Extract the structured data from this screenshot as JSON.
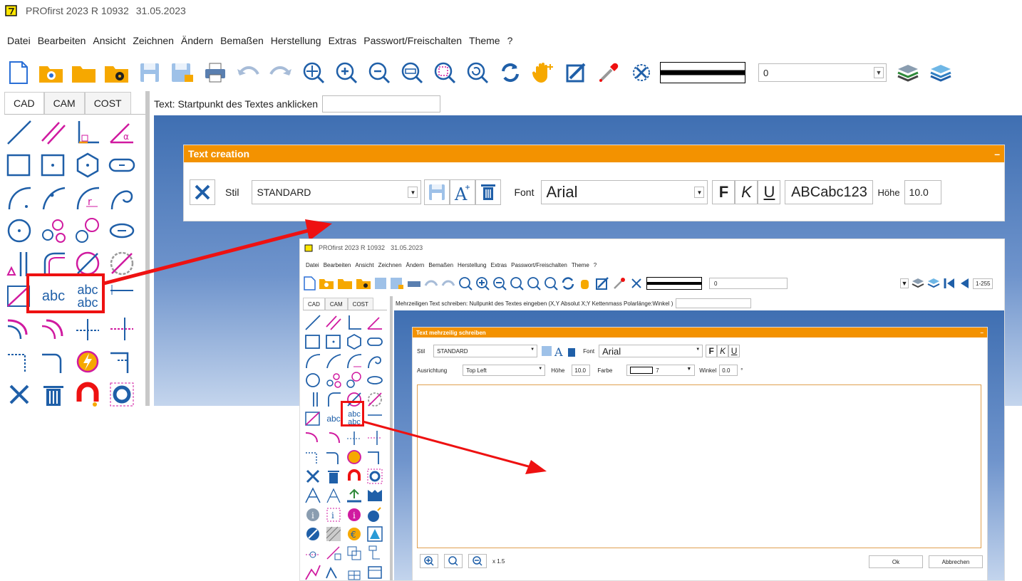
{
  "header_caption": "",
  "app": {
    "title": "PROfirst 2023 R 10932",
    "date": "31.05.2023"
  },
  "menu": [
    "Datei",
    "Bearbeiten",
    "Ansicht",
    "Zeichnen",
    "Ändern",
    "Bemaßen",
    "Herstellung",
    "Extras",
    "Passwort/Freischalten",
    "Theme",
    "?"
  ],
  "toolbar": {
    "layer_value": "0"
  },
  "tabs": [
    "CAD",
    "CAM",
    "COST"
  ],
  "prompt": {
    "text": "Text: Startpunkt des Textes anklicken",
    "value": ""
  },
  "text_creation": {
    "title": "Text creation",
    "collapse": "–",
    "stil_label": "Stil",
    "stil_value": "STANDARD",
    "font_label": "Font",
    "font_value": "Arial",
    "bold": "F",
    "italic": "K",
    "underline": "U",
    "preview": "ABCabc123",
    "hoehe_label": "Höhe",
    "hoehe_value": "10.0"
  },
  "palette_text": {
    "abc": "abc",
    "abc2": "abc"
  },
  "inset": {
    "app": {
      "title": "PROfirst 2023 R 10932",
      "date": "31.05.2023"
    },
    "menu": [
      "Datei",
      "Bearbeiten",
      "Ansicht",
      "Zeichnen",
      "Ändern",
      "Bemaßen",
      "Herstellung",
      "Extras",
      "Passwort/Freischalten",
      "Theme",
      "?"
    ],
    "layer_value": "0",
    "range": "1-255",
    "tabs": [
      "CAD",
      "CAM",
      "COST"
    ],
    "prompt": "Mehrzeiligen Text schreiben: Nullpunkt des Textes eingeben  (X,Y Absolut X;Y Kettenmass Polarlänge:Winkel )",
    "panel": {
      "title": "Text mehrzeilig schreiben",
      "collapse": "–",
      "stil_label": "Stil",
      "stil_value": "STANDARD",
      "font_label": "Font",
      "font_value": "Arial",
      "bold": "F",
      "italic": "K",
      "underline": "U",
      "ausrichtung_label": "Ausrichtung",
      "ausrichtung_value": "Top Left",
      "hoehe_label": "Höhe",
      "hoehe_value": "10.0",
      "farbe_label": "Farbe",
      "farbe_value": "7",
      "winkel_label": "Winkel",
      "winkel_value": "0.0",
      "degree": "°",
      "zoom": "x 1.5",
      "ok": "Ok",
      "cancel": "Abbrechen"
    }
  },
  "colors": {
    "accent": "#f39200",
    "highlight": "#e11111",
    "tool_blue": "#1f5fa8",
    "tool_magenta": "#d01aa0"
  }
}
